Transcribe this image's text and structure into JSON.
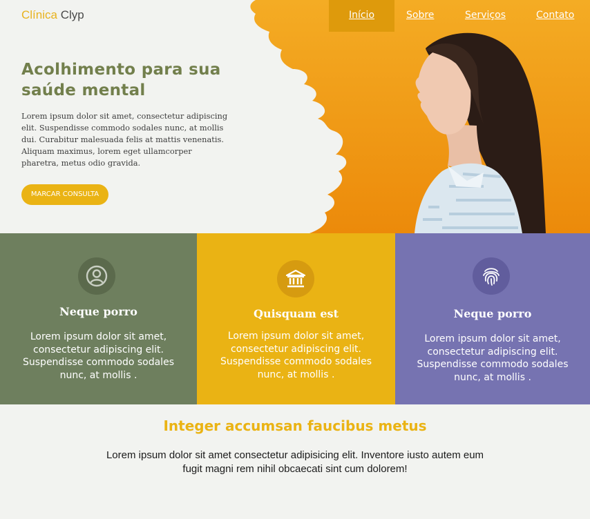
{
  "header": {
    "brand_part1": "Clínica",
    "brand_part2": "Clyp",
    "nav": [
      {
        "label": "Início",
        "active": true
      },
      {
        "label": "Sobre"
      },
      {
        "label": "Serviços"
      },
      {
        "label": "Contato"
      }
    ]
  },
  "hero": {
    "title_line1": "Acolhimento para sua",
    "title_line2": "saúde mental",
    "text": "Lorem ipsum dolor sit amet, consectetur adipiscing elit. Suspendisse commodo sodales nunc, at mollis dui. Curabitur malesuada felis at mattis venenatis. Aliquam maximus, lorem eget ullamcorper pharetra, metus odio gravida.",
    "cta_label": "MARCAR CONSULTA"
  },
  "features": [
    {
      "icon": "user-circle-icon",
      "title": "Neque porro",
      "text": "Lorem ipsum dolor sit amet, consectetur adipiscing elit. Suspendisse commodo sodales nunc, at mollis ."
    },
    {
      "icon": "bank-icon",
      "title": "Quisquam est",
      "text": "Lorem ipsum dolor sit amet, consectetur adipiscing elit. Suspendisse commodo sodales nunc, at mollis ."
    },
    {
      "icon": "fingerprint-icon",
      "title": "Neque porro",
      "text": "Lorem ipsum dolor sit amet, consectetur adipiscing elit. Suspendisse commodo sodales nunc, at mollis ."
    }
  ],
  "section": {
    "title": "Integer accumsan faucibus metus",
    "text": "Lorem ipsum dolor sit amet consectetur adipisicing elit. Inventore iusto autem eum fugit magni rem nihil obcaecati sint cum dolorem!"
  },
  "colors": {
    "accent": "#eab314",
    "olive": "#6e7f5e",
    "violet": "#7673b1",
    "title_green": "#727f4c"
  }
}
